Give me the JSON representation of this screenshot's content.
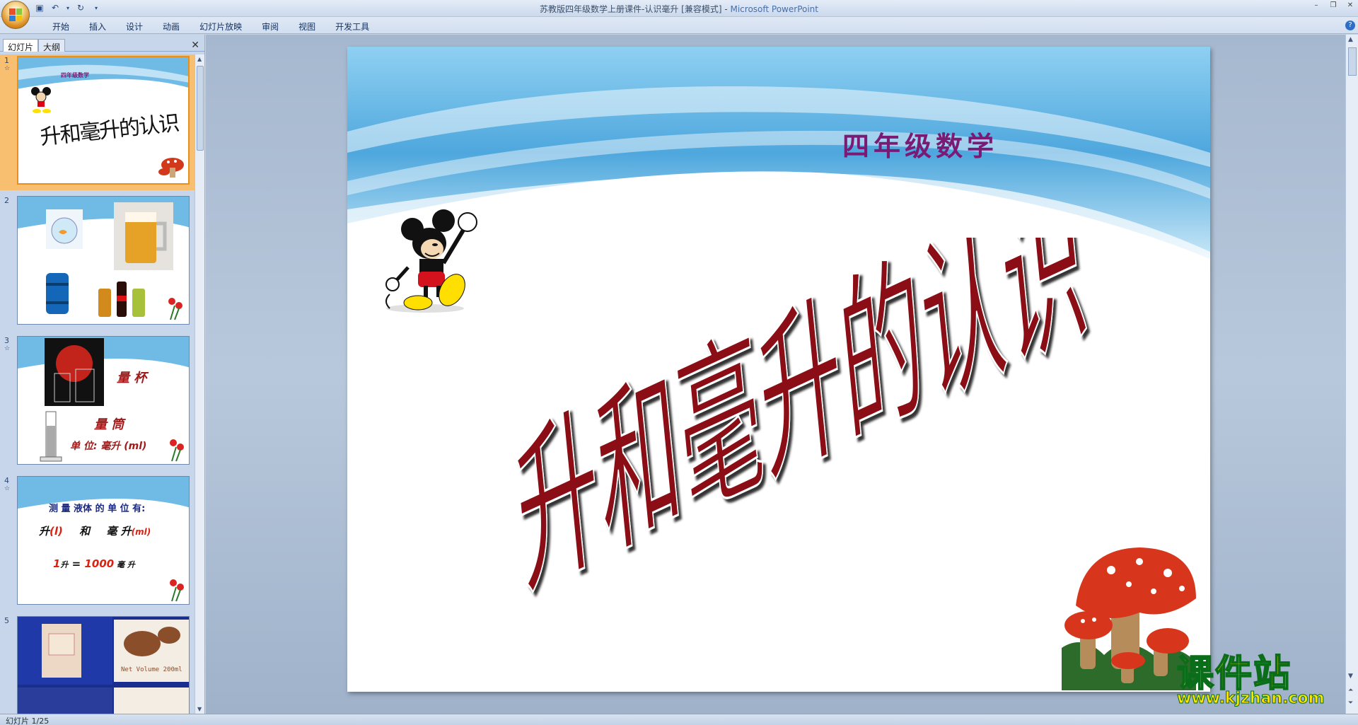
{
  "window": {
    "title": "苏教版四年级数学上册课件-认识毫升 [兼容模式]",
    "title_sep": " - ",
    "app_name": "Microsoft PowerPoint"
  },
  "ribbon": {
    "tabs": [
      "开始",
      "插入",
      "设计",
      "动画",
      "幻灯片放映",
      "审阅",
      "视图",
      "开发工具"
    ]
  },
  "left_pane": {
    "tabs": [
      "幻灯片",
      "大纲"
    ],
    "thumbnails": [
      {
        "num": "1",
        "title": "升和毫升的认识",
        "subtitle": "四年级数学"
      },
      {
        "num": "2"
      },
      {
        "num": "3",
        "label1": "量 杯",
        "label2": "量 筒",
        "label3": "单 位: 毫升 (ml)"
      },
      {
        "num": "4",
        "line1": "测 量 液体 的 单 位 有:",
        "line2a": "升",
        "line2b": "(l)",
        "line2c": "和",
        "line2d": "毫 升",
        "line2e": "(ml)",
        "line3a": "1",
        "line3b": "升",
        "line3c": " = ",
        "line3d": "1000",
        "line3e": " 毫 升"
      },
      {
        "num": "5",
        "text": "Net Volume 200ml"
      }
    ]
  },
  "slide": {
    "subtitle": "四年级数学",
    "title": "升和毫升的认识"
  },
  "status": {
    "slide_indicator": "幻灯片 1/25"
  },
  "watermark": {
    "main": "课件站",
    "url": "www.kjzhan.com"
  },
  "colors": {
    "title_fill": "#8b0f12",
    "subtitle": "#7a1a74",
    "sky": "#4ea7dd"
  }
}
